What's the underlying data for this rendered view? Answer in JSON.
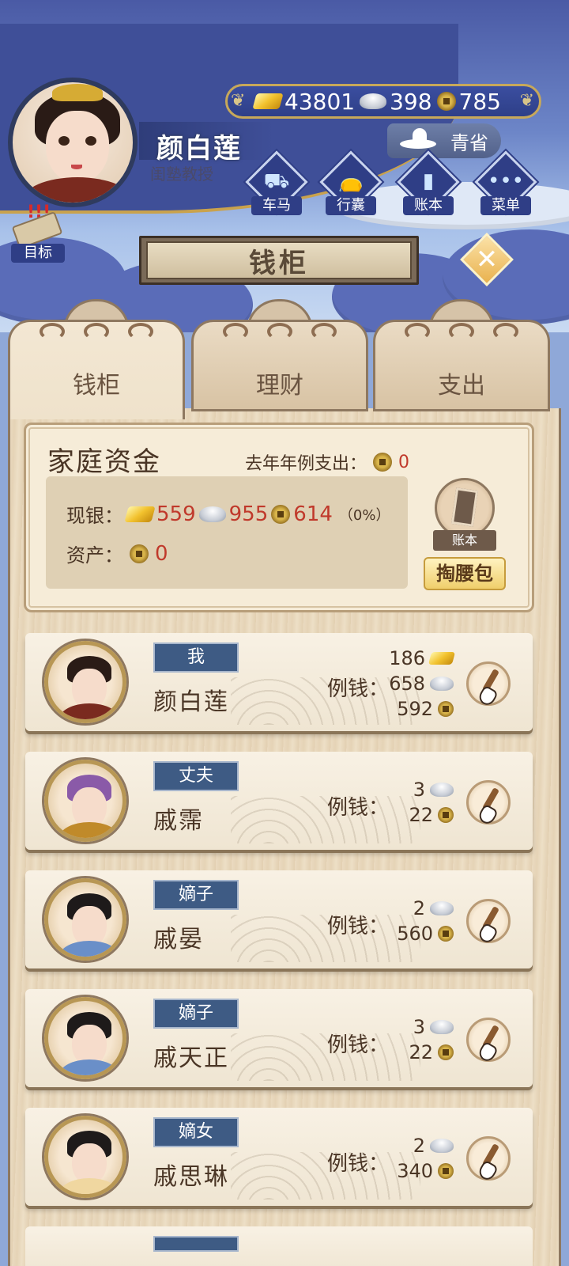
{
  "player": {
    "name": "颜白莲",
    "title": "闺塾教授",
    "rank": "青省"
  },
  "currency": {
    "gold": "43801",
    "silver": "398",
    "coin": "785"
  },
  "menu": {
    "carriage": "车马",
    "luggage": "行囊",
    "ledger": "账本",
    "menu": "菜单",
    "more_glyph": "•••",
    "target": "目标"
  },
  "page": {
    "title": "钱柜",
    "close_glyph": "✕"
  },
  "tabs": [
    {
      "label": "钱柜",
      "active": true
    },
    {
      "label": "理财",
      "active": false
    },
    {
      "label": "支出",
      "active": false
    }
  ],
  "fund": {
    "title": "家庭资金",
    "last_year_label": "去年年例支出：",
    "last_year_value": "0",
    "cash_label": "现银：",
    "cash_gold": "559",
    "cash_silver": "955",
    "cash_coin": "614",
    "cash_pct": "（0%）",
    "asset_label": "资产：",
    "asset_value": "0",
    "ledger_label": "账本",
    "purse_label": "掏腰包"
  },
  "allowance_label": "例钱：",
  "members": [
    {
      "role": "我",
      "name": "颜白莲",
      "gold": "186",
      "silver": "658",
      "coin": "592",
      "hair": "#2a1b16",
      "robe": "#7a2a1f"
    },
    {
      "role": "丈夫",
      "name": "戚霈",
      "silver": "3",
      "coin": "22",
      "hair": "#8a5aa8",
      "robe": "#c08a2a"
    },
    {
      "role": "嫡子",
      "name": "戚晏",
      "silver": "2",
      "coin": "560",
      "hair": "#1e1a1a",
      "robe": "#6a8fc8"
    },
    {
      "role": "嫡子",
      "name": "戚天正",
      "silver": "3",
      "coin": "22",
      "hair": "#1e1a1a",
      "robe": "#6a8fc8"
    },
    {
      "role": "嫡女",
      "name": "戚思琳",
      "silver": "2",
      "coin": "340",
      "hair": "#1e1a1a",
      "robe": "#f0d7a0"
    }
  ],
  "colors": {
    "accent_blue": "#3e5b84",
    "value_red": "#c0392b",
    "panel_wood": "#eadac0"
  }
}
